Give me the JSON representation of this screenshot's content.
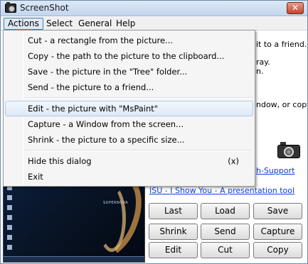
{
  "window": {
    "title": "ScreenShot",
    "close_glyph": "✕"
  },
  "menubar": {
    "items": [
      {
        "label": "Actions"
      },
      {
        "label": "Select"
      },
      {
        "label": "General"
      },
      {
        "label": "Help"
      }
    ]
  },
  "background": {
    "text_right_1": "it to a friend.",
    "text_right_2": "ray.",
    "text_right_3": "n.",
    "text_right_4": "ndow, or copy",
    "link_support": "h-Support",
    "link_isu": "ISU - I Show You - A presentation tool"
  },
  "preview": {
    "caption": "SUPERNOVA"
  },
  "buttons": {
    "last": "Last",
    "load": "Load",
    "save": "Save",
    "shrink": "Shrink",
    "send": "Send",
    "capture": "Capture",
    "edit": "Edit",
    "cut": "Cut",
    "copy": "Copy"
  },
  "actions_menu": {
    "items": [
      {
        "label": "Cut - a rectangle from the  picture..."
      },
      {
        "label": "Copy - the path to the picture to the clipboard..."
      },
      {
        "label": "Save - the picture in the \"Tree\" folder..."
      },
      {
        "label": "Send - the picture to a friend..."
      },
      {
        "label": "Edit - the picture with \"MsPaint\""
      },
      {
        "label": "Capture - a Window from the screen..."
      },
      {
        "label": "Shrink - the picture to a specific size..."
      },
      {
        "label": "Hide this dialog",
        "shortcut": "(x)"
      },
      {
        "label": "Exit"
      }
    ]
  }
}
